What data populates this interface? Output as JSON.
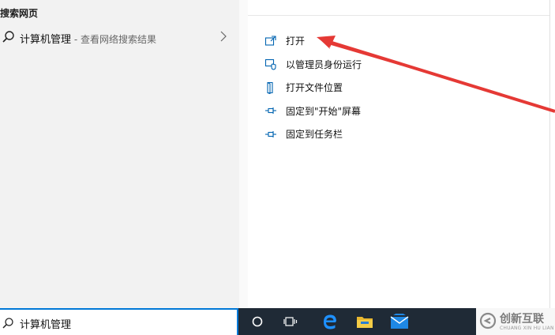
{
  "left_panel": {
    "section_heading": "搜索网页",
    "web_result": {
      "title": "计算机管理",
      "suffix": " - 查看网络搜索结果"
    }
  },
  "actions": [
    {
      "label": "打开",
      "icon": "open-icon"
    },
    {
      "label": "以管理员身份运行",
      "icon": "run-as-admin-icon"
    },
    {
      "label": "打开文件位置",
      "icon": "file-location-icon"
    },
    {
      "label": "固定到\"开始\"屏幕",
      "icon": "pin-icon"
    },
    {
      "label": "固定到任务栏",
      "icon": "pin-icon"
    }
  ],
  "search": {
    "value": "计算机管理"
  },
  "taskbar": {
    "items": [
      "cortana-icon",
      "task-view-icon",
      "edge-icon",
      "file-explorer-icon",
      "mail-icon"
    ]
  },
  "watermark": {
    "text": "创新互联",
    "sub": "CHUANG XIN HU LIAN"
  },
  "colors": {
    "accent": "#0078d7",
    "taskbar": "#1f2a36",
    "arrow": "#e53935"
  }
}
